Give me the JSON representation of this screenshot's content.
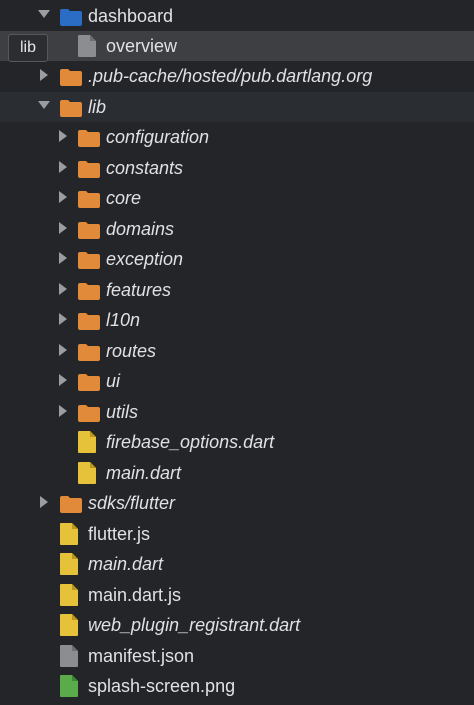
{
  "colors": {
    "background": "#232528",
    "folder_blue": "#2b6cc4",
    "folder_orange": "#e08a3a",
    "file_yellow": "#e6c23b",
    "file_gray": "#8b8d91",
    "file_green": "#5aab4a"
  },
  "tooltip": {
    "text": "lib"
  },
  "tree": [
    {
      "label": "dashboard",
      "icon": "folder-blue-icon",
      "arrow": "down"
    },
    {
      "label": "overview",
      "icon": "file-gray-icon"
    },
    {
      "label": ".pub-cache/hosted/pub.dartlang.org",
      "icon": "folder-orange-icon",
      "arrow": "right"
    },
    {
      "label": "lib",
      "icon": "folder-orange-icon",
      "arrow": "down"
    },
    {
      "label": "configuration",
      "icon": "folder-orange-icon",
      "arrow": "right"
    },
    {
      "label": "constants",
      "icon": "folder-orange-icon",
      "arrow": "right"
    },
    {
      "label": "core",
      "icon": "folder-orange-icon",
      "arrow": "right"
    },
    {
      "label": "domains",
      "icon": "folder-orange-icon",
      "arrow": "right"
    },
    {
      "label": "exception",
      "icon": "folder-orange-icon",
      "arrow": "right"
    },
    {
      "label": "features",
      "icon": "folder-orange-icon",
      "arrow": "right"
    },
    {
      "label": "l10n",
      "icon": "folder-orange-icon",
      "arrow": "right"
    },
    {
      "label": "routes",
      "icon": "folder-orange-icon",
      "arrow": "right"
    },
    {
      "label": "ui",
      "icon": "folder-orange-icon",
      "arrow": "right"
    },
    {
      "label": "utils",
      "icon": "folder-orange-icon",
      "arrow": "right"
    },
    {
      "label": "firebase_options.dart",
      "icon": "file-yellow-icon"
    },
    {
      "label": "main.dart",
      "icon": "file-yellow-icon"
    },
    {
      "label": "sdks/flutter",
      "icon": "folder-orange-icon",
      "arrow": "right"
    },
    {
      "label": "flutter.js",
      "icon": "file-yellow-icon"
    },
    {
      "label": "main.dart",
      "icon": "file-yellow-icon"
    },
    {
      "label": "main.dart.js",
      "icon": "file-yellow-icon"
    },
    {
      "label": "web_plugin_registrant.dart",
      "icon": "file-yellow-icon"
    },
    {
      "label": "manifest.json",
      "icon": "file-gray-icon"
    },
    {
      "label": "splash-screen.png",
      "icon": "file-green-icon"
    }
  ]
}
